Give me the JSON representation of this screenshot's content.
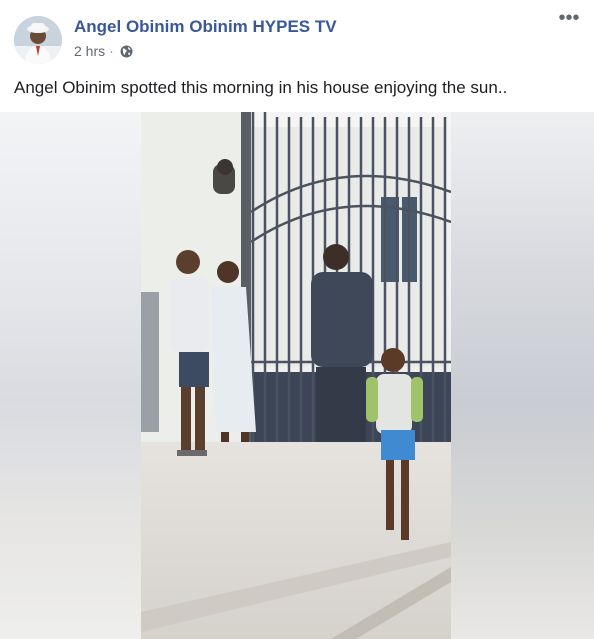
{
  "post": {
    "author": "Angel Obinim Obinim HYPES TV",
    "time": "2 hrs",
    "separator": "·",
    "privacy_icon": "globe-icon",
    "more_label": "•••",
    "caption": "Angel Obinim spotted this morning in his house enjoying the sun.."
  },
  "colors": {
    "author_link": "#385898",
    "meta_text": "#606770",
    "body_text": "#1c1e21"
  }
}
